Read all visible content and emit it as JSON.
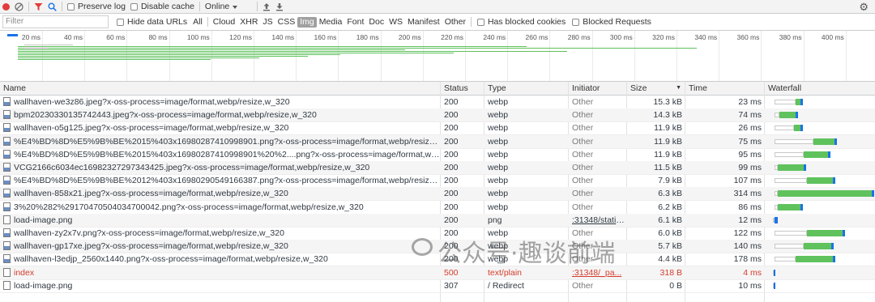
{
  "toolbar": {
    "preserve_log": "Preserve log",
    "disable_cache": "Disable cache",
    "throttling": "Online"
  },
  "filter": {
    "placeholder": "Filter",
    "hide_data_urls": "Hide data URLs",
    "types": [
      "All",
      "Cloud",
      "XHR",
      "JS",
      "CSS",
      "Img",
      "Media",
      "Font",
      "Doc",
      "WS",
      "Manifest",
      "Other"
    ],
    "active_type": "Img",
    "has_blocked_cookies": "Has blocked cookies",
    "blocked_requests": "Blocked Requests"
  },
  "overview": {
    "ticks": [
      "20 ms",
      "40 ms",
      "60 ms",
      "80 ms",
      "100 ms",
      "120 ms",
      "140 ms",
      "160 ms",
      "180 ms",
      "200 ms",
      "220 ms",
      "240 ms",
      "260 ms",
      "280 ms",
      "300 ms",
      "320 ms",
      "340 ms",
      "360 ms",
      "380 ms",
      "400 ms"
    ]
  },
  "columns": {
    "name": "Name",
    "status": "Status",
    "type": "Type",
    "initiator": "Initiator",
    "size": "Size",
    "time": "Time",
    "waterfall": "Waterfall"
  },
  "requests": [
    {
      "name": "wallhaven-we3z86.jpeg?x-oss-process=image/format,webp/resize,w_320",
      "status": "200",
      "type": "webp",
      "initiator": "Other",
      "size": "15.3 kB",
      "time": "23 ms",
      "wait": [
        4,
        30
      ],
      "recv": [
        30,
        36
      ]
    },
    {
      "name": "bpm20230330135742443.jpeg?x-oss-process=image/format,webp/resize,w_320",
      "status": "200",
      "type": "webp",
      "initiator": "Other",
      "size": "14.3 kB",
      "time": "74 ms",
      "wait": [
        4,
        10
      ],
      "recv": [
        10,
        30
      ]
    },
    {
      "name": "wallhaven-o5g125.jpeg?x-oss-process=image/format,webp/resize,w_320",
      "status": "200",
      "type": "webp",
      "initiator": "Other",
      "size": "11.9 kB",
      "time": "26 ms",
      "wait": [
        4,
        28
      ],
      "recv": [
        28,
        36
      ]
    },
    {
      "name": "%E4%BD%8D%E5%9B%BE%2015%403x16980287410998901.png?x-oss-process=image/format,webp/resize,w_320",
      "status": "200",
      "type": "webp",
      "initiator": "Other",
      "size": "11.9 kB",
      "time": "75 ms",
      "wait": [
        4,
        52
      ],
      "recv": [
        52,
        78
      ]
    },
    {
      "name": "%E4%BD%8D%E5%9B%BE%2015%403x16980287410998901%20%2....png?x-oss-process=image/format,webp/resiz...",
      "status": "200",
      "type": "webp",
      "initiator": "Other",
      "size": "11.9 kB",
      "time": "95 ms",
      "wait": [
        4,
        40
      ],
      "recv": [
        40,
        70
      ]
    },
    {
      "name": "VCG2166c6034ec16982327297343425.jpeg?x-oss-process=image/format,webp/resize,w_320",
      "status": "200",
      "type": "webp",
      "initiator": "Other",
      "size": "11.5 kB",
      "time": "99 ms",
      "wait": [
        4,
        8
      ],
      "recv": [
        8,
        40
      ]
    },
    {
      "name": "%E4%BD%8D%E5%9B%BE%2012%403x16980290549166387.png?x-oss-process=image/format,webp/resize,w_320",
      "status": "200",
      "type": "webp",
      "initiator": "Other",
      "size": "7.9 kB",
      "time": "107 ms",
      "wait": [
        4,
        44
      ],
      "recv": [
        44,
        76
      ]
    },
    {
      "name": "wallhaven-858x21.jpeg?x-oss-process=image/format,webp/resize,w_320",
      "status": "200",
      "type": "webp",
      "initiator": "Other",
      "size": "6.3 kB",
      "time": "314 ms",
      "wait": [
        4,
        8
      ],
      "recv": [
        8,
        124
      ]
    },
    {
      "name": "3%20%282%29170470504034700042.png?x-oss-process=image/format,webp/resize,w_320",
      "status": "200",
      "type": "webp",
      "initiator": "Other",
      "size": "6.2 kB",
      "time": "86 ms",
      "wait": [
        4,
        8
      ],
      "recv": [
        8,
        36
      ]
    },
    {
      "name": "load-image.png",
      "status": "200",
      "type": "png",
      "initiator": ":31348/static...",
      "size": "6.1 kB",
      "time": "12 ms",
      "wait": [
        2,
        4
      ],
      "recv": [
        4,
        8
      ],
      "doc": true
    },
    {
      "name": "wallhaven-zy2x7v.png?x-oss-process=image/format,webp/resize,w_320",
      "status": "200",
      "type": "webp",
      "initiator": "Other",
      "size": "6.0 kB",
      "time": "122 ms",
      "wait": [
        4,
        44
      ],
      "recv": [
        44,
        88
      ]
    },
    {
      "name": "wallhaven-gp17xe.jpeg?x-oss-process=image/format,webp/resize,w_320",
      "status": "200",
      "type": "webp",
      "initiator": "Other",
      "size": "5.7 kB",
      "time": "140 ms",
      "wait": [
        4,
        40
      ],
      "recv": [
        40,
        74
      ]
    },
    {
      "name": "wallhaven-l3edjp_2560x1440.png?x-oss-process=image/format,webp/resize,w_320",
      "status": "200",
      "type": "webp",
      "initiator": "Other",
      "size": "4.4 kB",
      "time": "178 ms",
      "wait": [
        4,
        30
      ],
      "recv": [
        30,
        76
      ]
    },
    {
      "name": "index",
      "status": "500",
      "type": "text/plain",
      "initiator": ":31348/_pa...",
      "size": "318 B",
      "time": "4 ms",
      "wait": [
        2,
        3
      ],
      "recv": [
        3,
        5
      ],
      "error": true,
      "doc": true
    },
    {
      "name": "load-image.png",
      "status": "307",
      "type": "/ Redirect",
      "initiator": "Other",
      "size": "0 B",
      "time": "10 ms",
      "wait": [
        2,
        3
      ],
      "recv": [
        3,
        4
      ],
      "doc": true
    }
  ],
  "watermark": "公众号·趣谈前端",
  "colors": {
    "accent_blue": "#1a73e8",
    "recv_green": "#5fc25d",
    "error_red": "#d43c2c",
    "stripe": "#f5f5f5"
  }
}
